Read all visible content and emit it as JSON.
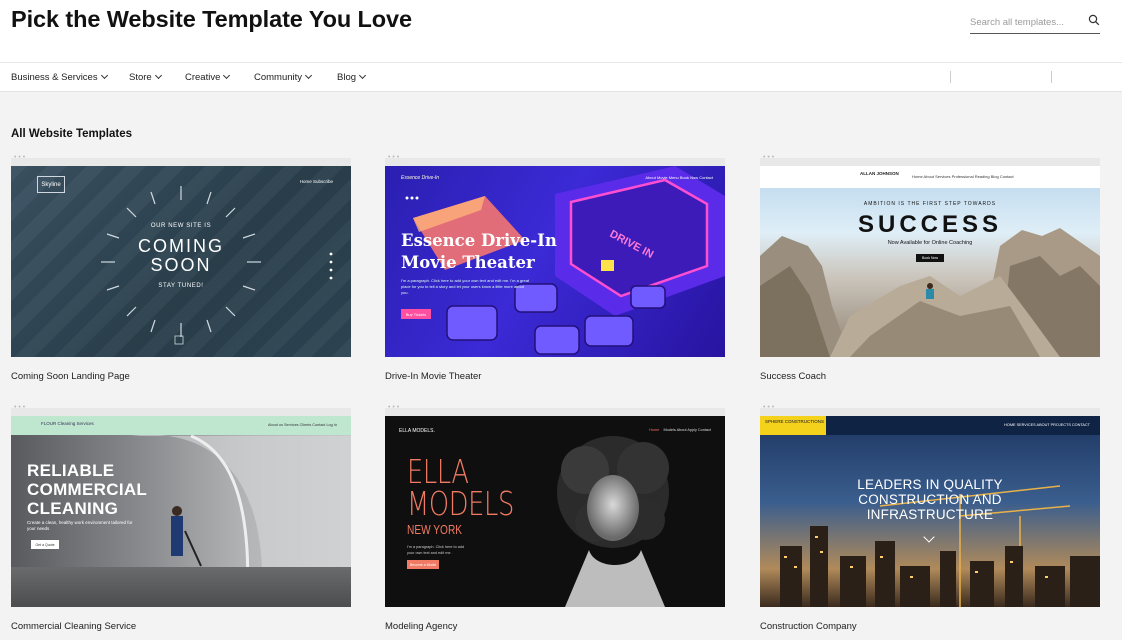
{
  "header": {
    "title": "Pick the Website Template You Love",
    "search_placeholder": "Search all templates..."
  },
  "nav": {
    "items": [
      {
        "label": "Business & Services"
      },
      {
        "label": "Store"
      },
      {
        "label": "Creative"
      },
      {
        "label": "Community"
      },
      {
        "label": "Blog"
      }
    ]
  },
  "main": {
    "section_title": "All Website Templates",
    "cards": [
      {
        "caption": "Coming Soon Landing Page",
        "preview": {
          "logo": "Skyline",
          "menu": "Home    Subscribe",
          "small_top": "OUR NEW SITE IS",
          "big1": "COMING",
          "big2": "SOON",
          "small_bottom": "STAY TUNED!"
        }
      },
      {
        "caption": "Drive-In Movie Theater",
        "preview": {
          "logo": "Essence Drive-In",
          "menu": "About    Movie Menu    Book Now    Contact",
          "headline1": "Essence Drive-In",
          "headline2": "Movie Theater",
          "para": "I'm a paragraph. Click here to add your own text and edit me. I'm a great place for you to tell a story and let your users know a little more about you.",
          "button": "Buy Tickets",
          "sign": "DRIVE IN"
        }
      },
      {
        "caption": "Success Coach",
        "preview": {
          "name": "ALLAN JOHNSON",
          "menu": "Home    About    Services    Professional Reading    Blog    Contact",
          "small": "AMBITION IS THE FIRST STEP TOWARDS",
          "big": "SUCCESS",
          "sub": "Now Available for Online Coaching",
          "button": "Book Now"
        }
      },
      {
        "caption": "Commercial Cleaning Service",
        "preview": {
          "brand": "FLOUR Cleaning Services",
          "menu": "About us    Services    Clients    Contact    Log In",
          "headline1": "RELIABLE",
          "headline2": "COMMERCIAL",
          "headline3": "CLEANING",
          "para": "Create a clean, healthy work environment tailored for your needs",
          "button": "Get a Quote"
        }
      },
      {
        "caption": "Modeling Agency",
        "preview": {
          "brand": "ELLA MODELS.",
          "menu_active": "Home",
          "menu": "Models    About    Apply    Contact",
          "big1": "ELLA",
          "big2": "MODELS",
          "sub": "NEW YORK",
          "para": "I'm a paragraph. Click here to add your own text and edit me.",
          "button": "Become a Model"
        }
      },
      {
        "caption": "Construction Company",
        "preview": {
          "badge": "SPHERE CONSTRUCTIONS",
          "menu": "HOME    SERVICES    ABOUT    PROJECTS    CONTACT",
          "headline1": "LEADERS IN QUALITY",
          "headline2": "CONSTRUCTION AND",
          "headline3": "INFRASTRUCTURE"
        }
      }
    ]
  },
  "colors": {
    "accent_pink": "#ff4fa0",
    "coral": "#f07a63",
    "yellow": "#f4d11a",
    "mint": "#bfe6cf"
  },
  "icons": [
    "search-icon",
    "chevron-down-icon"
  ]
}
